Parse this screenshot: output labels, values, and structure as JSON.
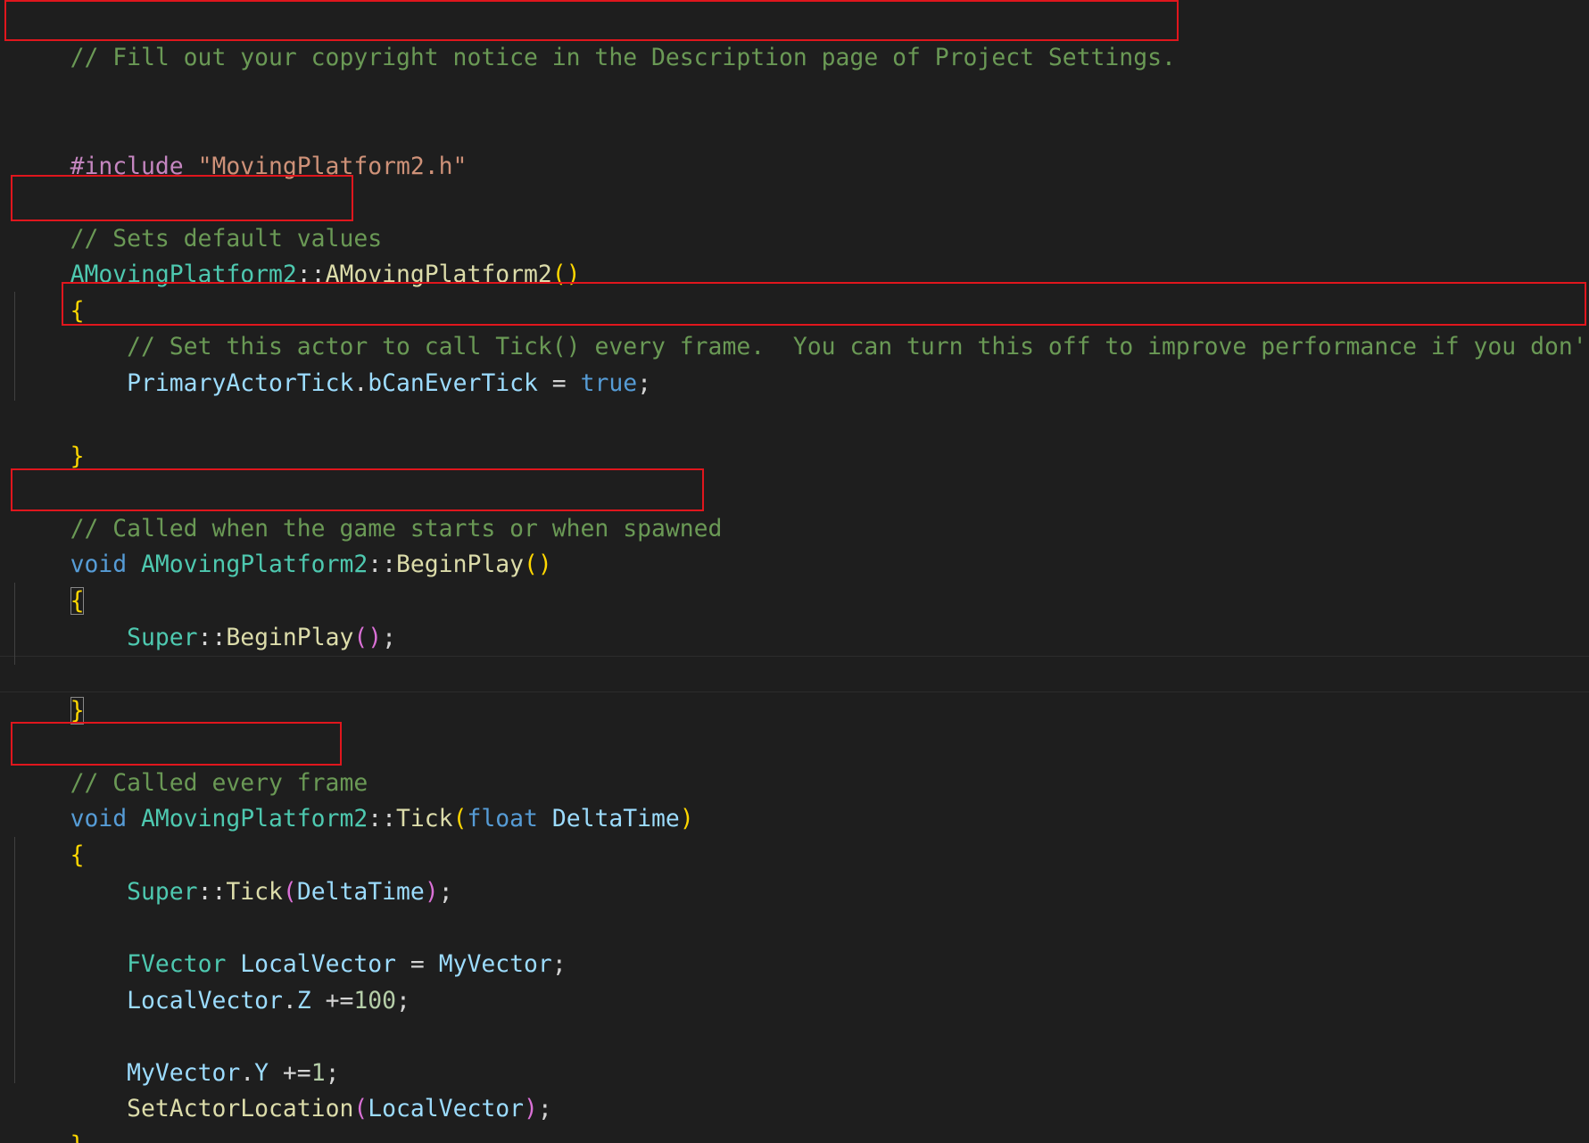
{
  "colors": {
    "background": "#1e1e1e",
    "comment": "#6a9955",
    "preprocessor": "#c586c0",
    "string": "#ce9178",
    "type": "#4ec9b0",
    "function": "#dcdcaa",
    "keyword": "#569cd6",
    "variable": "#9cdcfe",
    "number": "#b5cea8",
    "bracket_level1": "#ffd700",
    "bracket_level2": "#da70d6",
    "annotation_box": "#e0161d"
  },
  "code": {
    "l1": {
      "comment": "// Fill out your copyright notice in the Description page of Project Settings."
    },
    "l4": {
      "directive": "#include",
      "space": " ",
      "path": "\"MovingPlatform2.h\""
    },
    "l6": {
      "comment": "// Sets default values"
    },
    "l7": {
      "class": "AMovingPlatform2",
      "scope": "::",
      "ctor": "AMovingPlatform2",
      "paren_open": "(",
      "paren_close": ")"
    },
    "l8": {
      "brace": "{"
    },
    "l9": {
      "indent": "    ",
      "comment": "// Set this actor to call Tick() every frame.  You can turn this off to improve performance if you don'"
    },
    "l10": {
      "indent": "    ",
      "obj": "PrimaryActorTick",
      "dot": ".",
      "member": "bCanEverTick",
      "assign": " = ",
      "value": "true",
      "semi": ";"
    },
    "l12": {
      "brace": "}"
    },
    "l14": {
      "comment": "// Called when the game starts or when spawned"
    },
    "l15": {
      "kw": "void",
      "space": " ",
      "class": "AMovingPlatform2",
      "scope": "::",
      "fn": "BeginPlay",
      "paren_open": "(",
      "paren_close": ")"
    },
    "l16": {
      "brace": "{"
    },
    "l17": {
      "indent": "    ",
      "super": "Super",
      "scope": "::",
      "fn": "BeginPlay",
      "paren_open": "(",
      "paren_close": ")",
      "semi": ";"
    },
    "l19": {
      "brace": "}"
    },
    "l21": {
      "comment": "// Called every frame"
    },
    "l22": {
      "kw": "void",
      "space": " ",
      "class": "AMovingPlatform2",
      "scope": "::",
      "fn": "Tick",
      "paren_open": "(",
      "param_type": "float",
      "space2": " ",
      "param": "DeltaTime",
      "paren_close": ")"
    },
    "l23": {
      "brace": "{"
    },
    "l24": {
      "indent": "    ",
      "super": "Super",
      "scope": "::",
      "fn": "Tick",
      "paren_open": "(",
      "arg": "DeltaTime",
      "paren_close": ")",
      "semi": ";"
    },
    "l26": {
      "indent": "    ",
      "type": "FVector",
      "space": " ",
      "var": "LocalVector",
      "assign": " = ",
      "value": "MyVector",
      "semi": ";"
    },
    "l27": {
      "indent": "    ",
      "obj": "LocalVector",
      "dot": ".",
      "member": "Z",
      "op": " +=",
      "num": "100",
      "semi": ";"
    },
    "l29": {
      "indent": "    ",
      "obj": "MyVector",
      "dot": ".",
      "member": "Y",
      "op": " +=",
      "num": "1",
      "semi": ";"
    },
    "l30": {
      "indent": "    ",
      "fn": "SetActorLocation",
      "paren_open": "(",
      "arg": "LocalVector",
      "paren_close": ")",
      "semi": ";"
    },
    "l31": {
      "brace": "}"
    }
  }
}
